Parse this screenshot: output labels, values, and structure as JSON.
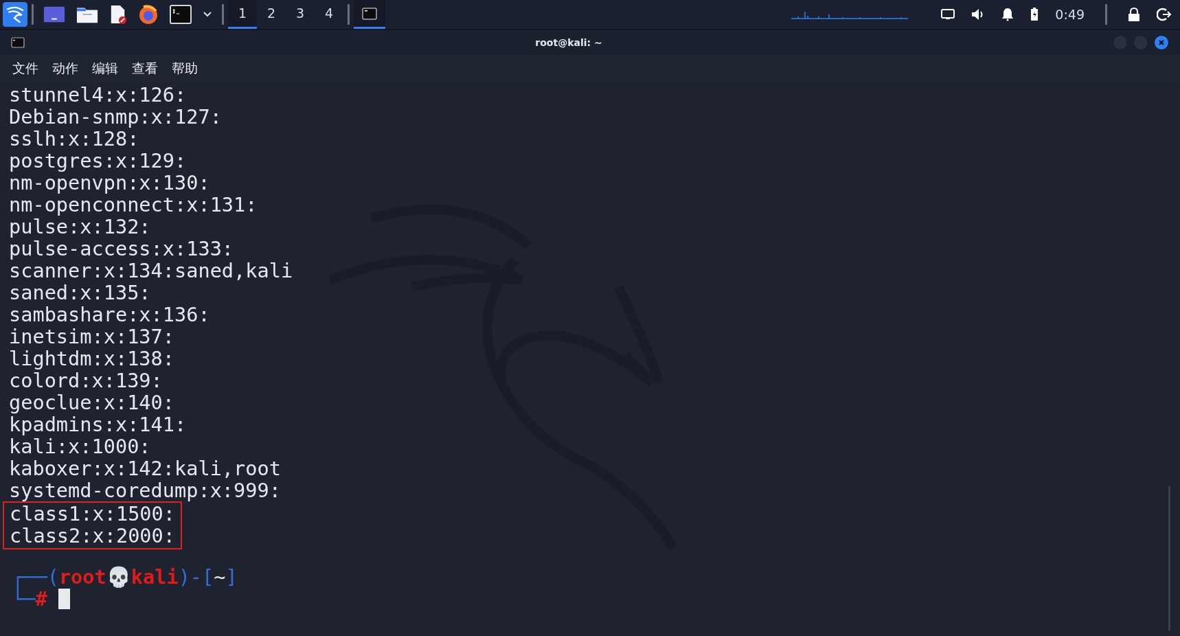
{
  "taskbar": {
    "workspaces": [
      {
        "label": "1",
        "selected": true
      },
      {
        "label": "2",
        "selected": false
      },
      {
        "label": "3",
        "selected": false
      },
      {
        "label": "4",
        "selected": false
      }
    ],
    "window_button": {
      "selected": true
    },
    "clock": "0:49"
  },
  "window": {
    "title": "root@kali: ~"
  },
  "menu": [
    "文件",
    "动作",
    "编辑",
    "查看",
    "帮助"
  ],
  "output_lines": [
    "stunnel4:x:126:",
    "Debian-snmp:x:127:",
    "sslh:x:128:",
    "postgres:x:129:",
    "nm-openvpn:x:130:",
    "nm-openconnect:x:131:",
    "pulse:x:132:",
    "pulse-access:x:133:",
    "scanner:x:134:saned,kali",
    "saned:x:135:",
    "sambashare:x:136:",
    "inetsim:x:137:",
    "lightdm:x:138:",
    "colord:x:139:",
    "geoclue:x:140:",
    "kpadmins:x:141:",
    "kali:x:1000:",
    "kaboxer:x:142:kali,root",
    "systemd-coredump:x:999:"
  ],
  "highlighted_lines": [
    "class1:x:1500:",
    "class2:x:2000:"
  ],
  "prompt": {
    "corner_top": "┌──(",
    "user": "root",
    "separator": "💀",
    "host": "kali",
    "mid": ")-[",
    "cwd": "~",
    "close": "]",
    "corner_bottom": "└─",
    "symbol": "#"
  }
}
